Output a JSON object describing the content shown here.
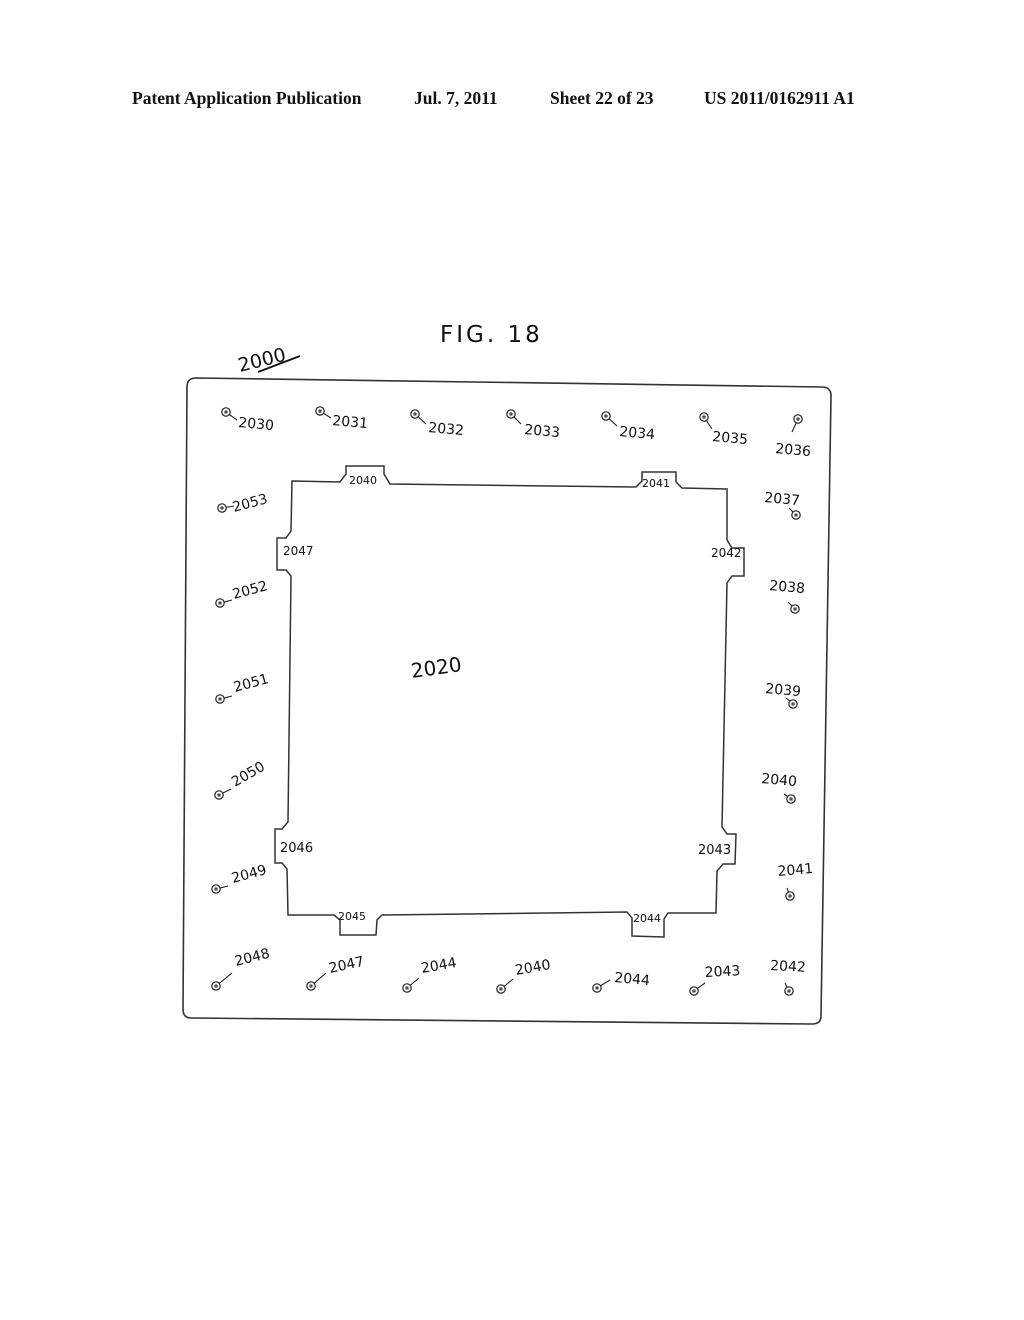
{
  "header": {
    "publication_type": "Patent Application Publication",
    "date": "Jul. 7, 2011",
    "sheet": "Sheet 22 of 23",
    "publication_number": "US 2011/0162911 A1"
  },
  "figure": {
    "title": "FIG. 18",
    "assembly_ref": "2000",
    "center_ref": "2020",
    "inner_tab_labels": {
      "top_left": "2040",
      "top_right": "2041",
      "right_upper": "2042",
      "right_lower": "2043",
      "bottom_right": "2044",
      "bottom_left": "2045",
      "left_lower": "2046",
      "left_upper": "2047"
    },
    "perimeter_markers": {
      "top_row": [
        "2030",
        "2031",
        "2032",
        "2033",
        "2034",
        "2035",
        "2036"
      ],
      "right_column": [
        "2037",
        "2038",
        "2039",
        "2040",
        "2041"
      ],
      "bottom_row": [
        "2048",
        "2047",
        "2044",
        "2040",
        "2044",
        "2043",
        "2042"
      ],
      "left_column": [
        "2053",
        "2052",
        "2051",
        "2050",
        "2049"
      ]
    }
  }
}
